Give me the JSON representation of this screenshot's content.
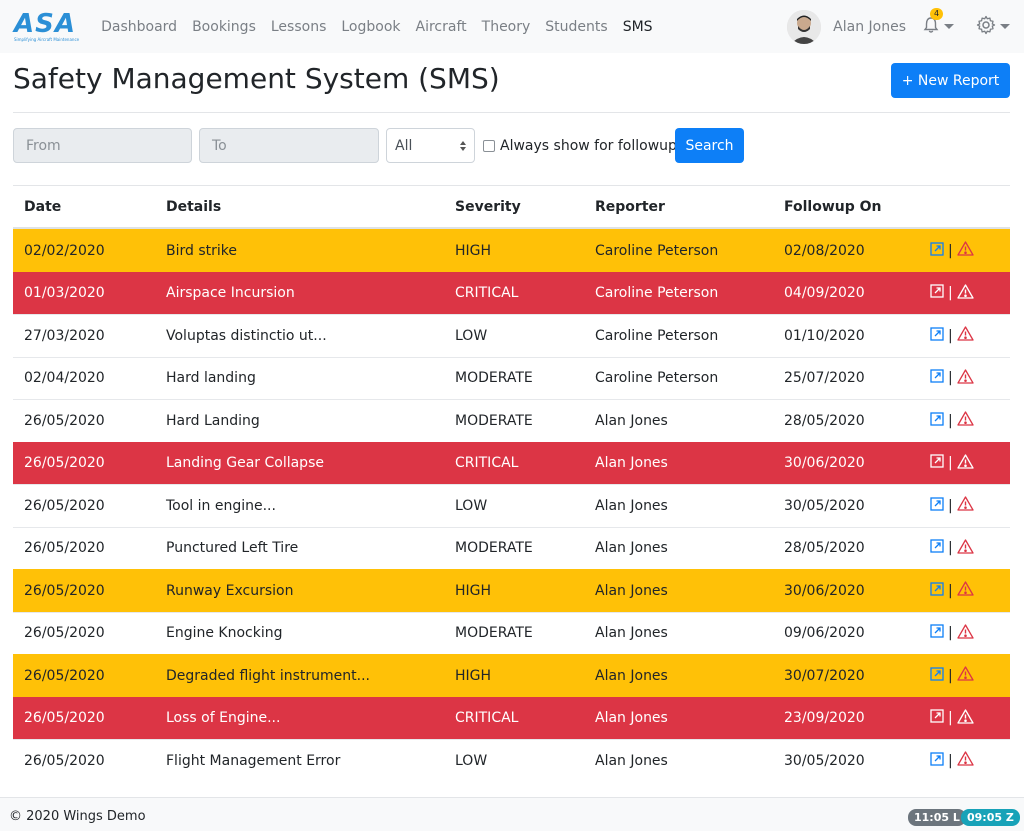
{
  "brand": {
    "logo": "ASA",
    "tagline": "Simplifying Aircraft Maintenance"
  },
  "nav": {
    "links": [
      "Dashboard",
      "Bookings",
      "Lessons",
      "Logbook",
      "Aircraft",
      "Theory",
      "Students",
      "SMS"
    ],
    "active": "SMS",
    "user_name": "Alan Jones",
    "notification_count": "4"
  },
  "page": {
    "title": "Safety Management System (SMS)",
    "new_report_label": "+ New Report"
  },
  "filters": {
    "from_placeholder": "From",
    "to_placeholder": "To",
    "severity_selected": "All",
    "followup_label": "Always show for followup",
    "search_label": "Search"
  },
  "table": {
    "headers": [
      "Date",
      "Details",
      "Severity",
      "Reporter",
      "Followup On"
    ],
    "rows": [
      {
        "date": "02/02/2020",
        "details": "Bird strike",
        "severity": "HIGH",
        "reporter": "Caroline Peterson",
        "followup": "02/08/2020"
      },
      {
        "date": "01/03/2020",
        "details": "Airspace Incursion",
        "severity": "CRITICAL",
        "reporter": "Caroline Peterson",
        "followup": "04/09/2020"
      },
      {
        "date": "27/03/2020",
        "details": "Voluptas distinctio ut...",
        "severity": "LOW",
        "reporter": "Caroline Peterson",
        "followup": "01/10/2020"
      },
      {
        "date": "02/04/2020",
        "details": "Hard landing",
        "severity": "MODERATE",
        "reporter": "Caroline Peterson",
        "followup": "25/07/2020"
      },
      {
        "date": "26/05/2020",
        "details": "Hard Landing",
        "severity": "MODERATE",
        "reporter": "Alan Jones",
        "followup": "28/05/2020"
      },
      {
        "date": "26/05/2020",
        "details": "Landing Gear Collapse",
        "severity": "CRITICAL",
        "reporter": "Alan Jones",
        "followup": "30/06/2020"
      },
      {
        "date": "26/05/2020",
        "details": "Tool in engine...",
        "severity": "LOW",
        "reporter": "Alan Jones",
        "followup": "30/05/2020"
      },
      {
        "date": "26/05/2020",
        "details": "Punctured Left Tire",
        "severity": "MODERATE",
        "reporter": "Alan Jones",
        "followup": "28/05/2020"
      },
      {
        "date": "26/05/2020",
        "details": "Runway Excursion",
        "severity": "HIGH",
        "reporter": "Alan Jones",
        "followup": "30/06/2020"
      },
      {
        "date": "26/05/2020",
        "details": "Engine Knocking",
        "severity": "MODERATE",
        "reporter": "Alan Jones",
        "followup": "09/06/2020"
      },
      {
        "date": "26/05/2020",
        "details": "Degraded flight instrument...",
        "severity": "HIGH",
        "reporter": "Alan Jones",
        "followup": "30/07/2020"
      },
      {
        "date": "26/05/2020",
        "details": "Loss of Engine...",
        "severity": "CRITICAL",
        "reporter": "Alan Jones",
        "followup": "23/09/2020"
      },
      {
        "date": "26/05/2020",
        "details": "Flight Management Error",
        "severity": "LOW",
        "reporter": "Alan Jones",
        "followup": "30/05/2020"
      }
    ],
    "action_separator": "|"
  },
  "footer": {
    "copyright": "© 2020 Wings Demo",
    "local_time": "11:05 L",
    "zulu_time": "09:05 Z"
  },
  "colors": {
    "primary": "#0d7ff7",
    "high": "#ffc107",
    "critical": "#dc3545",
    "zulu_badge": "#17a2b8",
    "local_badge": "#6c757d"
  },
  "icons": [
    "bell-icon",
    "gear-icon",
    "open-link-icon",
    "warning-icon"
  ]
}
